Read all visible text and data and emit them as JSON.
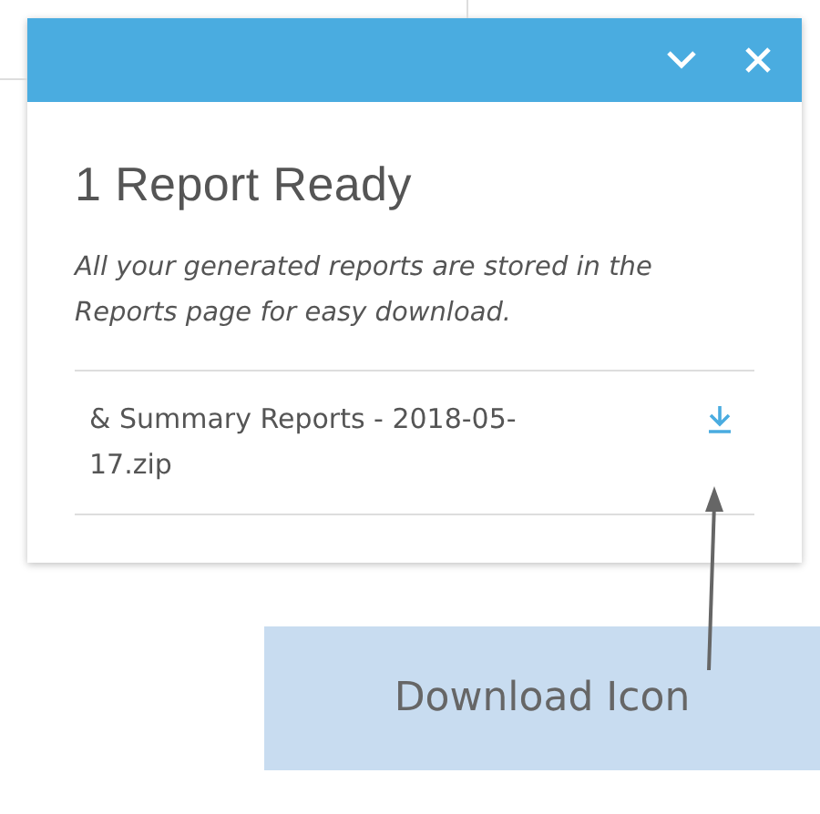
{
  "panel": {
    "title": "1 Report Ready",
    "description": "All your generated reports are stored in the Reports page for easy download.",
    "files": [
      {
        "name": "& Summary Reports - 2018-05-17.zip"
      }
    ]
  },
  "callout": {
    "label": "Download Icon"
  }
}
